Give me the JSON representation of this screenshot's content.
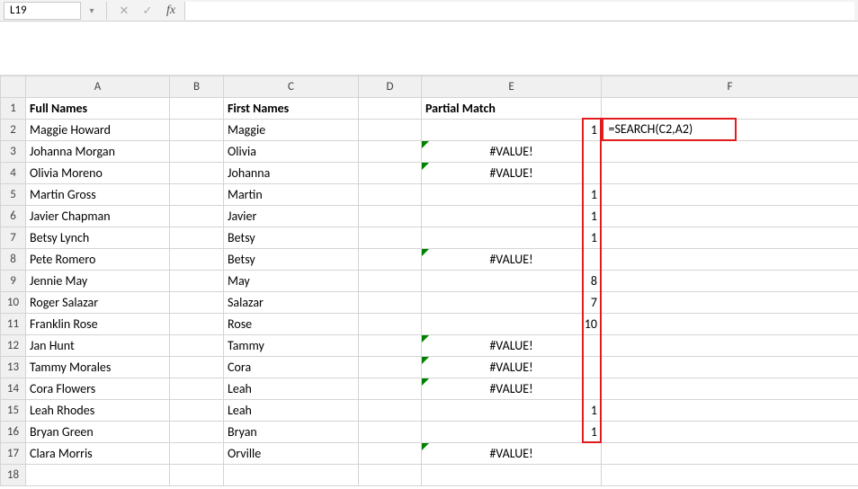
{
  "namebox": {
    "ref": "L19",
    "fx_label": "fx",
    "formula": ""
  },
  "columns": [
    "A",
    "B",
    "C",
    "D",
    "E",
    "F"
  ],
  "row_headers": [
    "1",
    "2",
    "3",
    "4",
    "5",
    "6",
    "7",
    "8",
    "9",
    "10",
    "11",
    "12",
    "13",
    "14",
    "15",
    "16",
    "17",
    "18"
  ],
  "header_row": {
    "A": "Full Names",
    "C": "First Names",
    "E": "Partial Match"
  },
  "rows": [
    {
      "A": "Maggie Howard",
      "C": "Maggie",
      "E": "1",
      "E_err": false,
      "E_align": "right"
    },
    {
      "A": "Johanna Morgan",
      "C": "Olivia",
      "E": "#VALUE!",
      "E_err": true,
      "E_align": "center"
    },
    {
      "A": "Olivia Moreno",
      "C": "Johanna",
      "E": "#VALUE!",
      "E_err": true,
      "E_align": "center"
    },
    {
      "A": "Martin Gross",
      "C": "Martin",
      "E": "1",
      "E_err": false,
      "E_align": "right"
    },
    {
      "A": "Javier Chapman",
      "C": "Javier",
      "E": "1",
      "E_err": false,
      "E_align": "right"
    },
    {
      "A": "Betsy Lynch",
      "C": "Betsy",
      "E": "1",
      "E_err": false,
      "E_align": "right"
    },
    {
      "A": "Pete Romero",
      "C": "Betsy",
      "E": "#VALUE!",
      "E_err": true,
      "E_align": "center"
    },
    {
      "A": "Jennie May",
      "C": "May",
      "E": "8",
      "E_err": false,
      "E_align": "right"
    },
    {
      "A": "Roger Salazar",
      "C": "Salazar",
      "E": "7",
      "E_err": false,
      "E_align": "right"
    },
    {
      "A": "Franklin Rose",
      "C": "Rose",
      "E": "10",
      "E_err": false,
      "E_align": "right"
    },
    {
      "A": "Jan Hunt",
      "C": "Tammy",
      "E": "#VALUE!",
      "E_err": true,
      "E_align": "center"
    },
    {
      "A": "Tammy Morales",
      "C": "Cora",
      "E": "#VALUE!",
      "E_err": true,
      "E_align": "center"
    },
    {
      "A": "Cora Flowers",
      "C": "Leah",
      "E": "#VALUE!",
      "E_err": true,
      "E_align": "center"
    },
    {
      "A": "Leah Rhodes",
      "C": "Leah",
      "E": "1",
      "E_err": false,
      "E_align": "right"
    },
    {
      "A": "Bryan Green",
      "C": "Bryan",
      "E": "1",
      "E_err": false,
      "E_align": "right"
    },
    {
      "A": "Clara Morris",
      "C": "Orville",
      "E": "#VALUE!",
      "E_err": true,
      "E_align": "center"
    }
  ],
  "annotations": {
    "formula_text": "=SEARCH(C2,A2)"
  },
  "chart_data": {
    "type": "table",
    "title": "",
    "columns": [
      "Full Names",
      "First Names",
      "Partial Match"
    ],
    "data": [
      [
        "Maggie Howard",
        "Maggie",
        1
      ],
      [
        "Johanna Morgan",
        "Olivia",
        "#VALUE!"
      ],
      [
        "Olivia Moreno",
        "Johanna",
        "#VALUE!"
      ],
      [
        "Martin Gross",
        "Martin",
        1
      ],
      [
        "Javier Chapman",
        "Javier",
        1
      ],
      [
        "Betsy Lynch",
        "Betsy",
        1
      ],
      [
        "Pete Romero",
        "Betsy",
        "#VALUE!"
      ],
      [
        "Jennie May",
        "May",
        8
      ],
      [
        "Roger Salazar",
        "Salazar",
        7
      ],
      [
        "Franklin Rose",
        "Rose",
        10
      ],
      [
        "Jan Hunt",
        "Tammy",
        "#VALUE!"
      ],
      [
        "Tammy Morales",
        "Cora",
        "#VALUE!"
      ],
      [
        "Cora Flowers",
        "Leah",
        "#VALUE!"
      ],
      [
        "Leah Rhodes",
        "Leah",
        1
      ],
      [
        "Bryan Green",
        "Bryan",
        1
      ],
      [
        "Clara Morris",
        "Orville",
        "#VALUE!"
      ]
    ],
    "formula": "=SEARCH(C2,A2)"
  }
}
